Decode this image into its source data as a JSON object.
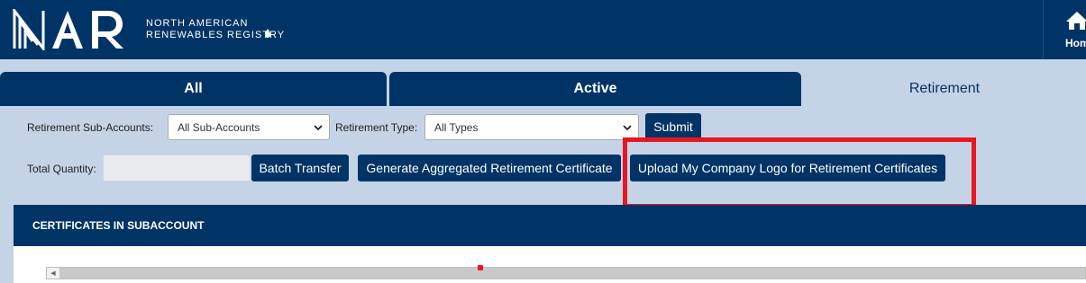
{
  "header": {
    "logo_mark": "NAR",
    "logo_line1": "NORTH AMERICAN",
    "logo_line2": "RENEWABLES REGISTRY",
    "home_label": "Home"
  },
  "tabs": [
    {
      "label": "All",
      "active": false
    },
    {
      "label": "Active",
      "active": false
    },
    {
      "label": "Retirement",
      "active": true
    }
  ],
  "filters": {
    "subaccounts_label": "Retirement Sub-Accounts:",
    "subaccounts_value": "All Sub-Accounts",
    "type_label": "Retirement Type:",
    "type_value": "All Types",
    "submit_label": "Submit"
  },
  "actions": {
    "total_quantity_label": "Total Quantity:",
    "total_quantity_value": "",
    "batch_transfer_label": "Batch Transfer",
    "generate_certificate_label": "Generate Aggregated Retirement Certificate",
    "upload_logo_label": "Upload My Company Logo for Retirement Certificates"
  },
  "panel": {
    "title": "CERTIFICATES IN SUBACCOUNT"
  },
  "colors": {
    "navy": "#003466",
    "background": "#c5d3e6",
    "highlight": "#e8171f"
  },
  "icons": {
    "home": "home-icon",
    "chevron": "chevron-down-icon",
    "scroll_left": "scroll-left-arrow-icon"
  }
}
